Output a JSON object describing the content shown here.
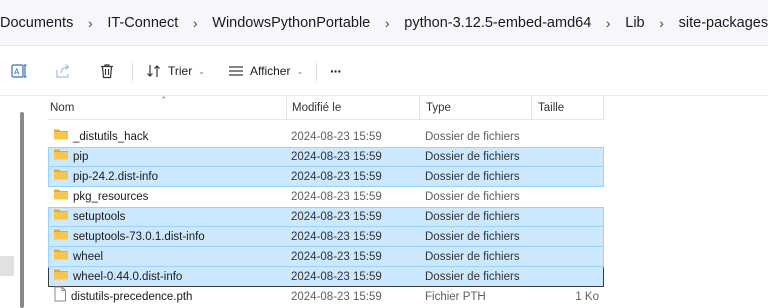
{
  "breadcrumb": {
    "items": [
      "Documents",
      "IT-Connect",
      "WindowsPythonPortable",
      "python-3.12.5-embed-amd64",
      "Lib",
      "site-packages"
    ],
    "separator": "›"
  },
  "toolbar": {
    "sort_label": "Trier",
    "view_label": "Afficher",
    "more_label": "···"
  },
  "columns": {
    "name": "Nom",
    "modified": "Modifié le",
    "type": "Type",
    "size": "Taille"
  },
  "files": [
    {
      "name": "_distutils_hack",
      "modified": "2024-08-23 15:59",
      "type": "Dossier de fichiers",
      "size": "",
      "icon": "folder-icon",
      "selected": false
    },
    {
      "name": "pip",
      "modified": "2024-08-23 15:59",
      "type": "Dossier de fichiers",
      "size": "",
      "icon": "folder-icon",
      "selected": true
    },
    {
      "name": "pip-24.2.dist-info",
      "modified": "2024-08-23 15:59",
      "type": "Dossier de fichiers",
      "size": "",
      "icon": "folder-icon",
      "selected": true
    },
    {
      "name": "pkg_resources",
      "modified": "2024-08-23 15:59",
      "type": "Dossier de fichiers",
      "size": "",
      "icon": "folder-icon",
      "selected": false
    },
    {
      "name": "setuptools",
      "modified": "2024-08-23 15:59",
      "type": "Dossier de fichiers",
      "size": "",
      "icon": "folder-icon",
      "selected": true
    },
    {
      "name": "setuptools-73.0.1.dist-info",
      "modified": "2024-08-23 15:59",
      "type": "Dossier de fichiers",
      "size": "",
      "icon": "folder-icon",
      "selected": true
    },
    {
      "name": "wheel",
      "modified": "2024-08-23 15:59",
      "type": "Dossier de fichiers",
      "size": "",
      "icon": "folder-icon",
      "selected": true
    },
    {
      "name": "wheel-0.44.0.dist-info",
      "modified": "2024-08-23 15:59",
      "type": "Dossier de fichiers",
      "size": "",
      "icon": "folder-icon",
      "selected": true,
      "focused": true
    },
    {
      "name": "distutils-precedence.pth",
      "modified": "2024-08-23 15:59",
      "type": "Fichier PTH",
      "size": "1 Ko",
      "icon": "file-icon",
      "selected": false
    }
  ],
  "colors": {
    "selection_fill": "#cce8ff",
    "selection_border": "#99d1ff",
    "folder": "#f3c24f",
    "accent": "#0067c0"
  }
}
